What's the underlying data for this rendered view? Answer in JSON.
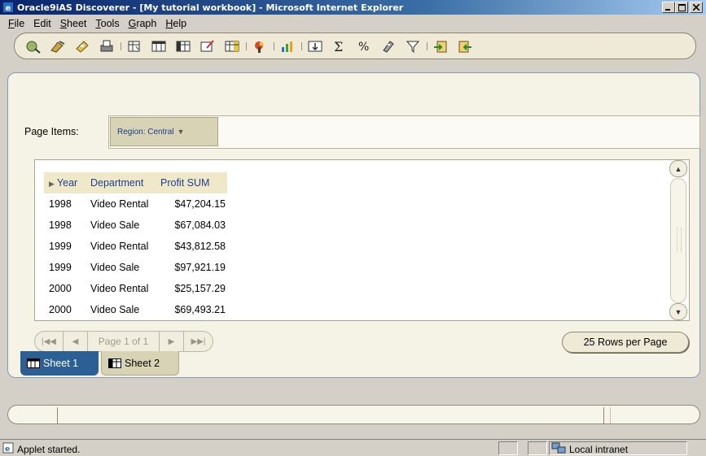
{
  "window": {
    "title": "Oracle9iAS Discoverer - [My tutorial workbook] - Microsoft Internet Explorer",
    "minimize_label": "_",
    "maximize_label": "□",
    "close_label": "×"
  },
  "menu": {
    "items": [
      {
        "label": "File",
        "underline": "F",
        "rest": "ile"
      },
      {
        "label": "Edit",
        "underline": "",
        "rest": "Edit"
      },
      {
        "label": "Sheet",
        "underline": "S",
        "rest": "heet"
      },
      {
        "label": "Tools",
        "underline": "T",
        "rest": "ools"
      },
      {
        "label": "Graph",
        "underline": "G",
        "rest": "raph"
      },
      {
        "label": "Help",
        "underline": "H",
        "rest": "elp"
      }
    ]
  },
  "toolbar": {
    "icons": [
      "new-workbook-icon",
      "open-workbook-icon",
      "save-icon",
      "print-icon",
      "new-sheet-icon",
      "table-icon",
      "crosstab-icon",
      "edit-sheet-icon",
      "pivot-icon",
      "format-icon",
      "graph-icon",
      "sort-icon",
      "sum-icon",
      "percent-icon",
      "calculation-icon",
      "filter-icon",
      "export-icon",
      "import-icon"
    ]
  },
  "page_items": {
    "label": "Page Items:",
    "region_chip": "Region: Central"
  },
  "grid": {
    "headers": [
      "Year",
      "Department",
      "Profit SUM"
    ],
    "rows": [
      [
        "1998",
        "Video Rental",
        "$47,204.15"
      ],
      [
        "1998",
        "Video Sale",
        "$67,084.03"
      ],
      [
        "1999",
        "Video Rental",
        "$43,812.58"
      ],
      [
        "1999",
        "Video Sale",
        "$97,921.19"
      ],
      [
        "2000",
        "Video Rental",
        "$25,157.29"
      ],
      [
        "2000",
        "Video Sale",
        "$69,493.21"
      ]
    ]
  },
  "pager": {
    "label": "Page 1 of 1",
    "rows_per_page": "25 Rows per Page"
  },
  "sheets": {
    "tabs": [
      "Sheet 1",
      "Sheet 2"
    ],
    "active": "Sheet 1"
  },
  "status": {
    "text": "Applet started.",
    "zone": "Local intranet"
  },
  "colors": {
    "titlebar": "#0a246a",
    "active_tab": "#2c5f94",
    "header_text": "#1f3f8c",
    "panel_bg": "#f5f2e6"
  }
}
